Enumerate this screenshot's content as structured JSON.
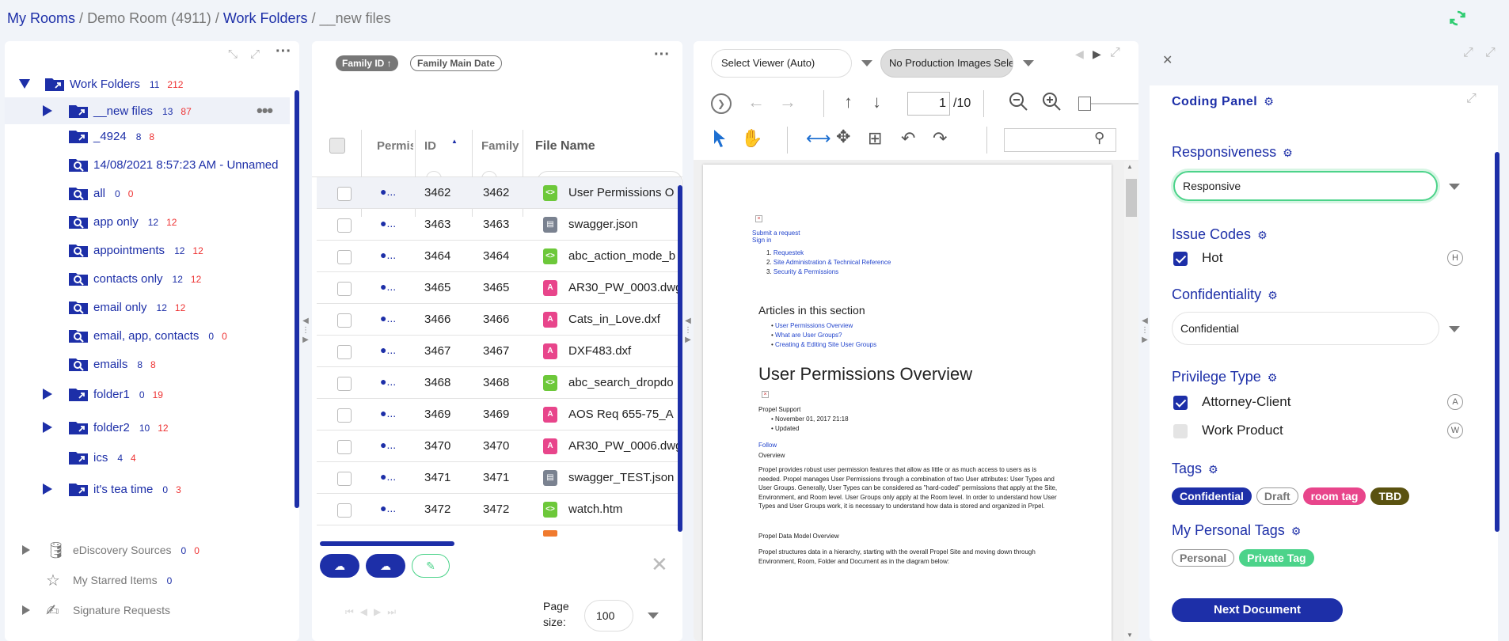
{
  "breadcrumb": {
    "root": "My Rooms",
    "sep": "/",
    "room": "Demo Room (4911)",
    "folders": "Work Folders",
    "current": "__new files"
  },
  "tree": {
    "items": [
      {
        "label": "Work Folders",
        "c1": "11",
        "c2": "212"
      },
      {
        "label": "__new files",
        "c1": "13",
        "c2": "87"
      },
      {
        "label": "_4924",
        "c1": "8",
        "c2": "8"
      },
      {
        "label": "14/08/2021 8:57:23 AM - Unnamed",
        "c1": "",
        "c2": ""
      },
      {
        "label": "all",
        "c1": "0",
        "c2": "0"
      },
      {
        "label": "app only",
        "c1": "12",
        "c2": "12"
      },
      {
        "label": "appointments",
        "c1": "12",
        "c2": "12"
      },
      {
        "label": "contacts only",
        "c1": "12",
        "c2": "12"
      },
      {
        "label": "email only",
        "c1": "12",
        "c2": "12"
      },
      {
        "label": "email, app, contacts",
        "c1": "0",
        "c2": "0"
      },
      {
        "label": "emails",
        "c1": "8",
        "c2": "8"
      },
      {
        "label": "folder1",
        "c1": "0",
        "c2": "19"
      },
      {
        "label": "folder2",
        "c1": "10",
        "c2": "12"
      },
      {
        "label": "ics",
        "c1": "4",
        "c2": "4"
      },
      {
        "label": "it's tea time",
        "c1": "0",
        "c2": "3"
      }
    ],
    "ediscovery": {
      "label": "eDiscovery Sources",
      "c1": "0",
      "c2": "0"
    },
    "starred": {
      "label": "My Starred Items",
      "c1": "0"
    },
    "signature": {
      "label": "Signature Requests"
    }
  },
  "grid": {
    "sort_chips": [
      "Family ID ↑",
      "Family Main Date"
    ],
    "headers": {
      "perms": "Permis",
      "id": "ID",
      "family": "Family",
      "filename": "File Name"
    },
    "rows": [
      {
        "id": "3462",
        "family": "3462",
        "type": "code",
        "name": "User Permissions O"
      },
      {
        "id": "3463",
        "family": "3463",
        "type": "json",
        "name": "swagger.json"
      },
      {
        "id": "3464",
        "family": "3464",
        "type": "code",
        "name": "abc_action_mode_b"
      },
      {
        "id": "3465",
        "family": "3465",
        "type": "cad",
        "name": "AR30_PW_0003.dwg"
      },
      {
        "id": "3466",
        "family": "3466",
        "type": "cad",
        "name": "Cats_in_Love.dxf"
      },
      {
        "id": "3467",
        "family": "3467",
        "type": "cad",
        "name": "DXF483.dxf"
      },
      {
        "id": "3468",
        "family": "3468",
        "type": "code",
        "name": "abc_search_dropdo"
      },
      {
        "id": "3469",
        "family": "3469",
        "type": "cad",
        "name": "AOS Req 655-75_A"
      },
      {
        "id": "3470",
        "family": "3470",
        "type": "cad",
        "name": "AR30_PW_0006.dwg"
      },
      {
        "id": "3471",
        "family": "3471",
        "type": "json",
        "name": "swagger_TEST.json"
      },
      {
        "id": "3472",
        "family": "3472",
        "type": "code",
        "name": "watch.htm"
      }
    ],
    "dot": "●...",
    "page_size_label": "Page size:",
    "page_size": "100"
  },
  "viewer": {
    "select_viewer": "Select Viewer (Auto)",
    "production": "No Production Images Select",
    "page": "1",
    "page_total": "/10",
    "doc": {
      "links1": [
        "Submit a request",
        "Sign in"
      ],
      "crumbs": [
        "Requestek",
        "Site Administration & Technical Reference",
        "Security & Permissions"
      ],
      "section_title": "Articles in this section",
      "articles": [
        "User Permissions Overview",
        "What are User Groups?",
        "Creating & Editing Site User Groups"
      ],
      "title": "User Permissions Overview",
      "author": "Propel Support",
      "meta": [
        "November 01, 2017 21:18",
        "Updated"
      ],
      "follow": "Follow",
      "overview": "Overview",
      "p1": "Propel provides robust user permission features that allow as little or as much access to users as is needed.  Propel manages User Permissions through a combination of two User attributes:  User Types and User Groups.  Generally, User Types can be considered as \"hard-coded\" permissions that apply at the Site, Environment, and Room level.  User Groups only apply at the Room level.  In order to understand how User Types and User Groups work, it is necessary to understand how data is stored and organized in Prpel.",
      "h2": "Propel Data Model Overview",
      "p2": "Propel structures data in a hierarchy, starting with the overall Propel Site and moving down through Environment, Room, Folder and Document as in the diagram below:"
    }
  },
  "coding": {
    "title": "Coding Panel",
    "responsiveness": {
      "label": "Responsiveness",
      "value": "Responsive"
    },
    "issue_codes": {
      "label": "Issue Codes",
      "items": [
        {
          "label": "Hot",
          "key": "H"
        }
      ]
    },
    "confidentiality": {
      "label": "Confidentiality",
      "value": "Confidential"
    },
    "privilege": {
      "label": "Privilege Type",
      "items": [
        {
          "label": "Attorney-Client",
          "key": "A"
        },
        {
          "label": "Work Product",
          "key": "W"
        }
      ]
    },
    "tags": {
      "label": "Tags",
      "items": [
        "Confidential",
        "Draft",
        "room tag",
        "TBD"
      ]
    },
    "personal_tags": {
      "label": "My Personal Tags",
      "items": [
        "Personal",
        "Private Tag"
      ]
    },
    "next": "Next Document"
  },
  "colors": {
    "accent": "#1d2fa8",
    "green": "#4cd38a",
    "pink": "#e8458b",
    "olive": "#5a5210",
    "red": "#e33333"
  }
}
